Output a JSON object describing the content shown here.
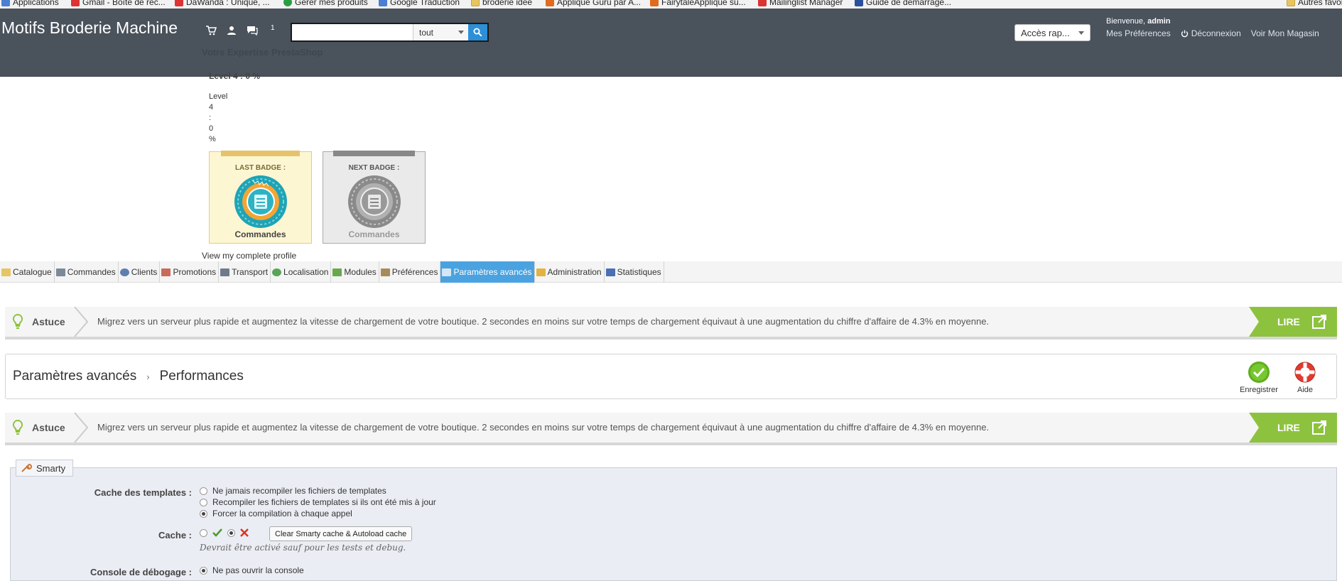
{
  "bookmarks": [
    {
      "label": "Applications",
      "icon": "apps-icon"
    },
    {
      "label": "Gmail - Boîte de réc...",
      "icon": "gmail-icon"
    },
    {
      "label": "DaWanda : Unique, ...",
      "icon": "dawanda-icon"
    },
    {
      "label": "Gérer mes produits",
      "icon": "green-icon"
    },
    {
      "label": "Google Traduction",
      "icon": "translate-icon"
    },
    {
      "label": "broderie idée",
      "icon": "folder-icon"
    },
    {
      "label": "Applique Guru par A...",
      "icon": "etsy-icon"
    },
    {
      "label": "FairytaleApplique su...",
      "icon": "etsy-icon"
    },
    {
      "label": "Mailinglist Manager",
      "icon": "s-icon"
    },
    {
      "label": "Guide de démarrage...",
      "icon": "prestashop-icon"
    },
    {
      "label": "Autres favoris",
      "icon": "folder-icon"
    }
  ],
  "header": {
    "shop_name": "Motifs Broderie Machine",
    "notification_count": "1",
    "search_placeholder": "",
    "search_scope": "tout",
    "quick_access": "Accès rap...",
    "welcome_prefix": "Bienvenue,",
    "welcome_user": "admin",
    "my_preferences": "Mes Préférences",
    "logout": "Déconnexion",
    "view_shop": "Voir Mon Magasin",
    "expertise": "Votre Expertise PrestaShop"
  },
  "badges": {
    "level_title": "Level 4 : 0 %",
    "level_stack": [
      "Level",
      "4",
      ":",
      "0",
      "%"
    ],
    "last_title": "LAST BADGE :",
    "last_name": "Commandes",
    "next_title": "NEXT BADGE :",
    "next_name": "Commandes",
    "profile_link": "View my complete profile"
  },
  "tabs": [
    {
      "label": "Catalogue",
      "color": "#e7c562"
    },
    {
      "label": "Commandes",
      "color": "#7a8a99"
    },
    {
      "label": "Clients",
      "color": "#5b7fb0"
    },
    {
      "label": "Promotions",
      "color": "#c96a5b"
    },
    {
      "label": "Transport",
      "color": "#6f7b8a"
    },
    {
      "label": "Localisation",
      "color": "#5aa35a"
    },
    {
      "label": "Modules",
      "color": "#6aa84f"
    },
    {
      "label": "Préférences",
      "color": "#a88b5a"
    },
    {
      "label": "Paramètres avancés",
      "color": "#d6e6f5",
      "active": true
    },
    {
      "label": "Administration",
      "color": "#e3b341"
    },
    {
      "label": "Statistiques",
      "color": "#4a6fb5"
    }
  ],
  "tip": {
    "label": "Astuce",
    "text": "Migrez vers un serveur plus rapide et augmentez la vitesse de chargement de votre boutique. 2 secondes en moins sur votre temps de chargement équivaut à une augmentation du chiffre d'affaire de 4.3% en moyenne.",
    "action": "LIRE"
  },
  "toolbar": {
    "crumb_parent": "Paramètres avancés",
    "crumb_separator": "›",
    "crumb_current": "Performances",
    "save_label": "Enregistrer",
    "help_label": "Aide"
  },
  "smarty": {
    "legend": "Smarty",
    "template_cache_label": "Cache des templates :",
    "template_cache_options": [
      {
        "label": "Ne jamais recompiler les fichiers de templates",
        "checked": false
      },
      {
        "label": "Recompiler les fichiers de templates si ils ont été mis à jour",
        "checked": false
      },
      {
        "label": "Forcer la compilation à chaque appel",
        "checked": true
      }
    ],
    "cache_label": "Cache :",
    "cache_enabled": false,
    "clear_button": "Clear Smarty cache & Autoload cache",
    "cache_help": "Devrait être activé sauf pour les tests et debug.",
    "debug_label": "Console de débogage :",
    "debug_option": "Ne pas ouvrir la console"
  }
}
